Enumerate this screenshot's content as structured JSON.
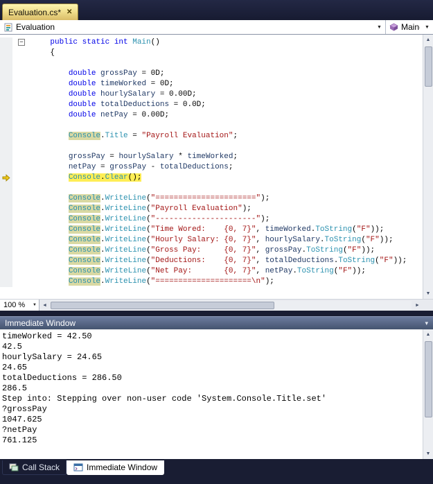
{
  "colors": {
    "shell_background": "#191d33",
    "active_tab_gold": "#e9d178",
    "current_statement_highlight": "#ffee55",
    "reference_highlight": "#d9d9a3",
    "keyword": "#0000e8",
    "type_and_method": "#2b91af",
    "variable": "#1f3864",
    "string": "#a31515",
    "editor_background": "#ffffff",
    "toolwindow_titlebar": "#45546f"
  },
  "icons": {
    "tab_close": "✕",
    "combo_arrow": "▼",
    "scroll_up": "▲",
    "scroll_down": "▼",
    "scroll_left": "◄",
    "scroll_right": "►",
    "fold_collapse": "−",
    "window_menu": "▾"
  },
  "tab": {
    "title": "Evaluation.cs*"
  },
  "navbar": {
    "type": "Evaluation",
    "member": "Main()"
  },
  "editor": {
    "zoom": "100 %",
    "lines": [
      {
        "fold": true,
        "s": [
          [
            "p",
            "    "
          ],
          [
            "k",
            "public static int "
          ],
          [
            "t",
            "Main"
          ],
          [
            "p",
            "()"
          ]
        ]
      },
      {
        "s": [
          [
            "p",
            "    {"
          ]
        ]
      },
      {
        "s": []
      },
      {
        "s": [
          [
            "p",
            "        "
          ],
          [
            "k",
            "double"
          ],
          [
            "p",
            " "
          ],
          [
            "v",
            "grossPay"
          ],
          [
            "p",
            " = 0D;"
          ]
        ]
      },
      {
        "s": [
          [
            "p",
            "        "
          ],
          [
            "k",
            "double"
          ],
          [
            "p",
            " "
          ],
          [
            "v",
            "timeWorked"
          ],
          [
            "p",
            " = 0D;"
          ]
        ]
      },
      {
        "s": [
          [
            "p",
            "        "
          ],
          [
            "k",
            "double"
          ],
          [
            "p",
            " "
          ],
          [
            "v",
            "hourlySalary"
          ],
          [
            "p",
            " = 0.00D;"
          ]
        ]
      },
      {
        "s": [
          [
            "p",
            "        "
          ],
          [
            "k",
            "double"
          ],
          [
            "p",
            " "
          ],
          [
            "v",
            "totalDeductions"
          ],
          [
            "p",
            " = 0.0D;"
          ]
        ]
      },
      {
        "s": [
          [
            "p",
            "        "
          ],
          [
            "k",
            "double"
          ],
          [
            "p",
            " "
          ],
          [
            "v",
            "netPay"
          ],
          [
            "p",
            " = 0.00D;"
          ]
        ]
      },
      {
        "s": []
      },
      {
        "s": [
          [
            "p",
            "        "
          ],
          [
            "hl",
            "Console"
          ],
          [
            "p",
            "."
          ],
          [
            "t",
            "Title"
          ],
          [
            "p",
            " = "
          ],
          [
            "s",
            "\"Payroll Evaluation\""
          ],
          [
            "p",
            ";"
          ]
        ]
      },
      {
        "s": []
      },
      {
        "s": [
          [
            "p",
            "        "
          ],
          [
            "v",
            "grossPay"
          ],
          [
            "p",
            " = "
          ],
          [
            "v",
            "hourlySalary"
          ],
          [
            "p",
            " * "
          ],
          [
            "v",
            "timeWorked"
          ],
          [
            "p",
            ";"
          ]
        ]
      },
      {
        "s": [
          [
            "p",
            "        "
          ],
          [
            "v",
            "netPay"
          ],
          [
            "p",
            " = "
          ],
          [
            "v",
            "grossPay"
          ],
          [
            "p",
            " - "
          ],
          [
            "v",
            "totalDeductions"
          ],
          [
            "p",
            ";"
          ]
        ]
      },
      {
        "cur": true,
        "s": [
          [
            "p",
            "        "
          ],
          [
            "t",
            "Console"
          ],
          [
            "p",
            "."
          ],
          [
            "t",
            "Clear"
          ],
          [
            "p",
            "();"
          ]
        ]
      },
      {
        "s": []
      },
      {
        "s": [
          [
            "p",
            "        "
          ],
          [
            "hl",
            "Console"
          ],
          [
            "p",
            "."
          ],
          [
            "t",
            "WriteLine"
          ],
          [
            "p",
            "("
          ],
          [
            "s",
            "\"======================\""
          ],
          [
            "p",
            ");"
          ]
        ]
      },
      {
        "s": [
          [
            "p",
            "        "
          ],
          [
            "hl",
            "Console"
          ],
          [
            "p",
            "."
          ],
          [
            "t",
            "WriteLine"
          ],
          [
            "p",
            "("
          ],
          [
            "s",
            "\"Payroll Evaluation\""
          ],
          [
            "p",
            ");"
          ]
        ]
      },
      {
        "s": [
          [
            "p",
            "        "
          ],
          [
            "hl",
            "Console"
          ],
          [
            "p",
            "."
          ],
          [
            "t",
            "WriteLine"
          ],
          [
            "p",
            "("
          ],
          [
            "s",
            "\"----------------------\""
          ],
          [
            "p",
            ");"
          ]
        ]
      },
      {
        "s": [
          [
            "p",
            "        "
          ],
          [
            "hl",
            "Console"
          ],
          [
            "p",
            "."
          ],
          [
            "t",
            "WriteLine"
          ],
          [
            "p",
            "("
          ],
          [
            "s",
            "\"Time Wored:    {0, 7}\""
          ],
          [
            "p",
            ", "
          ],
          [
            "v",
            "timeWorked"
          ],
          [
            "p",
            "."
          ],
          [
            "t",
            "ToString"
          ],
          [
            "p",
            "("
          ],
          [
            "s",
            "\"F\""
          ],
          [
            "p",
            "));"
          ]
        ]
      },
      {
        "s": [
          [
            "p",
            "        "
          ],
          [
            "hl",
            "Console"
          ],
          [
            "p",
            "."
          ],
          [
            "t",
            "WriteLine"
          ],
          [
            "p",
            "("
          ],
          [
            "s",
            "\"Hourly Salary: {0, 7}\""
          ],
          [
            "p",
            ", "
          ],
          [
            "v",
            "hourlySalary"
          ],
          [
            "p",
            "."
          ],
          [
            "t",
            "ToString"
          ],
          [
            "p",
            "("
          ],
          [
            "s",
            "\"F\""
          ],
          [
            "p",
            "));"
          ]
        ]
      },
      {
        "s": [
          [
            "p",
            "        "
          ],
          [
            "hl",
            "Console"
          ],
          [
            "p",
            "."
          ],
          [
            "t",
            "WriteLine"
          ],
          [
            "p",
            "("
          ],
          [
            "s",
            "\"Gross Pay:     {0, 7}\""
          ],
          [
            "p",
            ", "
          ],
          [
            "v",
            "grossPay"
          ],
          [
            "p",
            "."
          ],
          [
            "t",
            "ToString"
          ],
          [
            "p",
            "("
          ],
          [
            "s",
            "\"F\""
          ],
          [
            "p",
            "));"
          ]
        ]
      },
      {
        "s": [
          [
            "p",
            "        "
          ],
          [
            "hl",
            "Console"
          ],
          [
            "p",
            "."
          ],
          [
            "t",
            "WriteLine"
          ],
          [
            "p",
            "("
          ],
          [
            "s",
            "\"Deductions:    {0, 7}\""
          ],
          [
            "p",
            ", "
          ],
          [
            "v",
            "totalDeductions"
          ],
          [
            "p",
            "."
          ],
          [
            "t",
            "ToString"
          ],
          [
            "p",
            "("
          ],
          [
            "s",
            "\"F\""
          ],
          [
            "p",
            "));"
          ]
        ]
      },
      {
        "s": [
          [
            "p",
            "        "
          ],
          [
            "hl",
            "Console"
          ],
          [
            "p",
            "."
          ],
          [
            "t",
            "WriteLine"
          ],
          [
            "p",
            "("
          ],
          [
            "s",
            "\"Net Pay:       {0, 7}\""
          ],
          [
            "p",
            ", "
          ],
          [
            "v",
            "netPay"
          ],
          [
            "p",
            "."
          ],
          [
            "t",
            "ToString"
          ],
          [
            "p",
            "("
          ],
          [
            "s",
            "\"F\""
          ],
          [
            "p",
            "));"
          ]
        ]
      },
      {
        "s": [
          [
            "p",
            "        "
          ],
          [
            "hl",
            "Console"
          ],
          [
            "p",
            "."
          ],
          [
            "t",
            "WriteLine"
          ],
          [
            "p",
            "("
          ],
          [
            "s",
            "\"=====================\\n\""
          ],
          [
            "p",
            ");"
          ]
        ]
      }
    ]
  },
  "immediate": {
    "title": "Immediate Window",
    "lines": [
      "timeWorked = 42.50",
      "42.5",
      "hourlySalary = 24.65",
      "24.65",
      "totalDeductions = 286.50",
      "286.5",
      "Step into: Stepping over non-user code 'System.Console.Title.set'",
      "?grossPay",
      "1047.625",
      "?netPay",
      "761.125"
    ]
  },
  "bottom_tabs": [
    {
      "label": "Call Stack",
      "active": false
    },
    {
      "label": "Immediate Window",
      "active": true
    }
  ]
}
